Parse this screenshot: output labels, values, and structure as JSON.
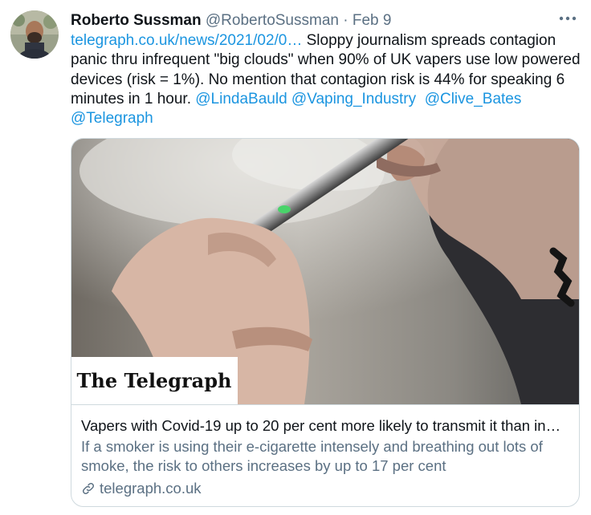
{
  "tweet": {
    "author_name": "Roberto Sussman",
    "author_handle": "@RobertoSussman",
    "separator": "·",
    "date": "Feb 9",
    "more_icon": "more-horizontal-icon",
    "text": {
      "link": "telegraph.co.uk/news/2021/02/0…",
      "line1_rest": " Sloppy journalism spreads contagion",
      "line2": "panic thru infrequent \"big clouds\" when 90% of UK vapers use low powered",
      "line3": "devices (risk = 1%). No mention that contagion risk is 44% for speaking 6",
      "line4_prefix": "minutes in 1 hour. ",
      "mention1": "@LindaBauld",
      "mention2": "@Vaping_Industry",
      "mention3": "@Clive_Bates",
      "mention4": "@Telegraph"
    },
    "card": {
      "brand_logo_text": "The Telegraph",
      "title": "Vapers with Covid-19 up to 20 per cent more likely to transmit it than in…",
      "description": "If a smoker is using their e-cigarette intensely and breathing out lots of smoke, the risk to others increases by up to 17 per cent",
      "domain": "telegraph.co.uk",
      "domain_icon": "link-icon"
    }
  }
}
